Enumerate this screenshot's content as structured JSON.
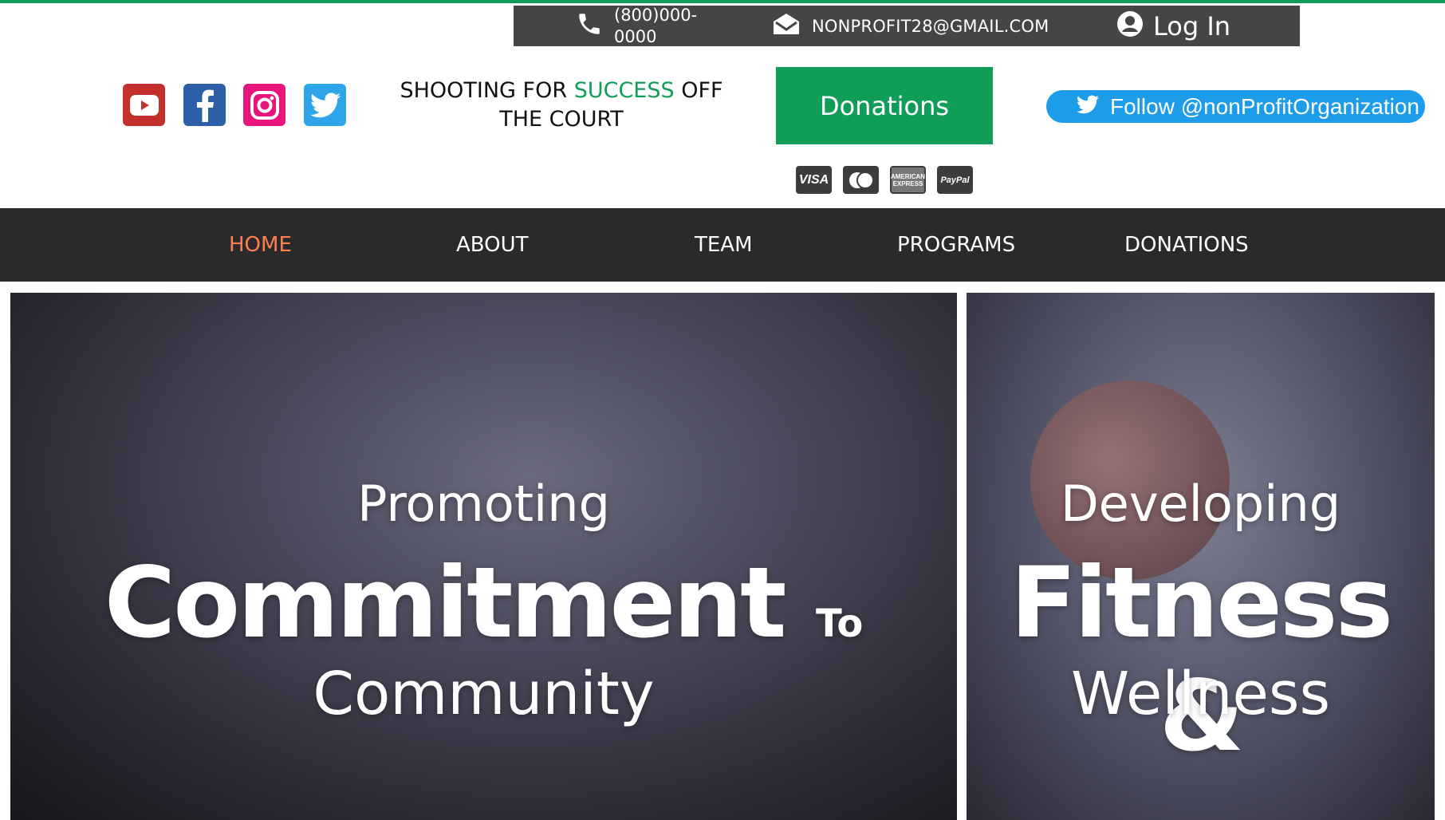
{
  "colors": {
    "accent": "#0f9d58",
    "nav_active": "#ff7f50",
    "twitter": "#1d9ce9"
  },
  "contact": {
    "phone": "(800)000-0000",
    "email": "NONPROFIT28@GMAIL.COM",
    "login_label": "Log In"
  },
  "social": [
    "youtube-icon",
    "facebook-icon",
    "instagram-icon",
    "twitter-icon"
  ],
  "tagline": {
    "part1": "SHOOTING FOR ",
    "accent": "SUCCESS",
    "part2": " OFF THE COURT"
  },
  "donate_label": "Donations",
  "payment_cards": {
    "visa": "VISA",
    "paypal": "PayPal",
    "amex": "AMERICAN EXPRESS"
  },
  "follow_label": "Follow @nonProfitOrganization",
  "nav": {
    "items": [
      "HOME",
      "ABOUT",
      "TEAM",
      "PROGRAMS",
      "DONATIONS"
    ],
    "active": "HOME"
  },
  "hero_left": {
    "top": "Promoting",
    "big": "Commitment",
    "small": "To",
    "bottom": "Community"
  },
  "hero_right": {
    "top": "Developing",
    "big": "Fitness &",
    "bottom": "Wellness"
  }
}
